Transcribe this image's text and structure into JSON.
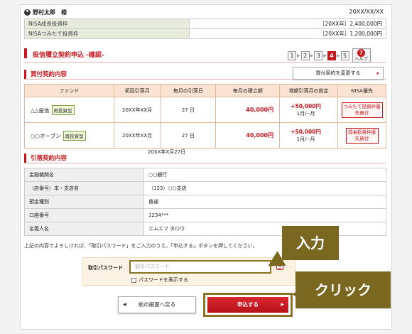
{
  "header": {
    "user_name": "野村太郎　様",
    "date": "20XX/XX/XX"
  },
  "nisa_limits": [
    {
      "label": "NISA成長投資枠",
      "value": "［20XX年］2,400,000円"
    },
    {
      "label": "NISAつみたて投資枠",
      "value": "［20XX年］1,200,000円"
    }
  ],
  "page_title": "投信積立契約申込 -確認-",
  "steps": [
    "1",
    "2",
    "3",
    "4",
    "5"
  ],
  "active_step": "4",
  "help_label": "ヘルプ",
  "purchase_section": {
    "title": "買付契約内容",
    "change_button": "買付契約を変更する"
  },
  "fund_table": {
    "headers": [
      "ファンド",
      "初回引落月",
      "毎月の引落日",
      "毎月の積立額",
      "増額引落月の指定",
      "NISA優先"
    ],
    "rows": [
      {
        "fund": "△△投信",
        "tag": "再投資型",
        "first_month": "20XX年XX月",
        "day": "27 日",
        "amount": "40,000円",
        "increase": "+50,000円",
        "increase_months": "1月/--月",
        "nisa": "つみたて投資枠優先買付"
      },
      {
        "fund": "○○オープン",
        "tag": "再投資型",
        "first_month": "20XX年XX月",
        "day": "27 日",
        "amount": "40,000円",
        "increase": "+50,000円",
        "increase_months": "1月/--月",
        "nisa": "成長投資枠優先買付"
      }
    ]
  },
  "withdrawal_section": {
    "title": "引落契約内容",
    "date": "20XX年X月27日"
  },
  "withdrawal_table": [
    {
      "label": "金融機関名",
      "value": "○○銀行"
    },
    {
      "label": "（店番号）本・支店名",
      "value": "（123）○○支店"
    },
    {
      "label": "預金種別",
      "value": "普通"
    },
    {
      "label": "口座番号",
      "value": "1234***"
    },
    {
      "label": "名義人名",
      "value": "エムエフ タロウ"
    }
  ],
  "confirm_text": "上記の内容でよろしければ、「取引パスワード」をご入力のうえ、「申込する」ボタンを押してください。",
  "password": {
    "label": "取引パスワード",
    "placeholder": "取引パスワード",
    "show_label": "パスワードを表示する"
  },
  "buttons": {
    "back": "前の画面へ戻る",
    "submit": "申込する"
  },
  "callouts": {
    "input": "入力",
    "click": "クリック"
  },
  "colors": {
    "brand_red": "#c8161d",
    "callout": "#7a6720"
  }
}
